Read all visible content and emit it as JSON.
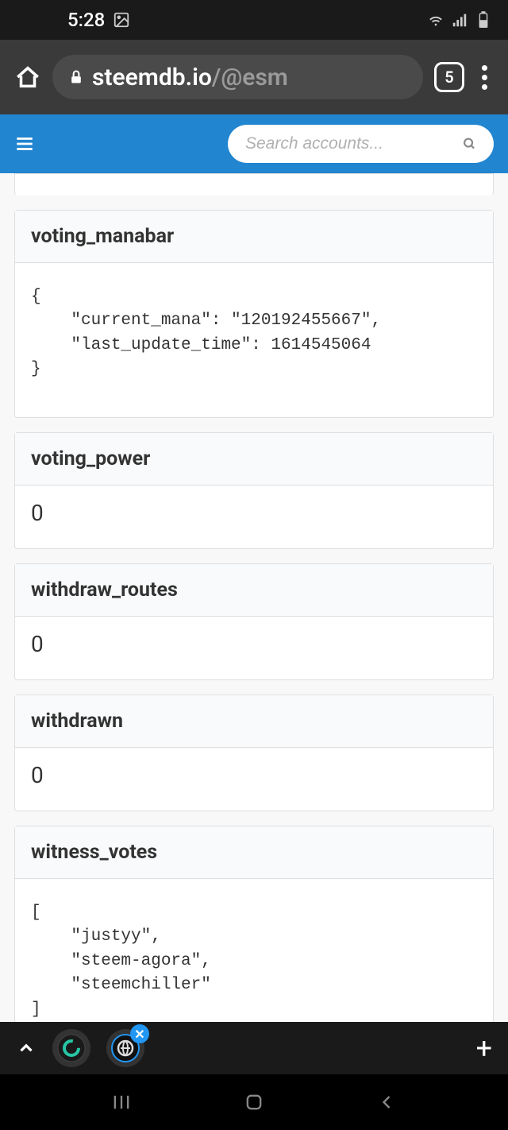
{
  "status": {
    "time": "5:28",
    "tabCount": "5"
  },
  "browser": {
    "domain": "steemdb.io",
    "path": "/@esm"
  },
  "search": {
    "placeholder": "Search accounts..."
  },
  "sections": {
    "voting_manabar": {
      "label": "voting_manabar",
      "value": "{\n    \"current_mana\": \"120192455667\",\n    \"last_update_time\": 1614545064\n}"
    },
    "voting_power": {
      "label": "voting_power",
      "value": "0"
    },
    "withdraw_routes": {
      "label": "withdraw_routes",
      "value": "0"
    },
    "withdrawn": {
      "label": "withdrawn",
      "value": "0"
    },
    "witness_votes": {
      "label": "witness_votes",
      "value": "[\n    \"justyy\",\n    \"steem-agora\",\n    \"steemchiller\"\n]"
    }
  }
}
